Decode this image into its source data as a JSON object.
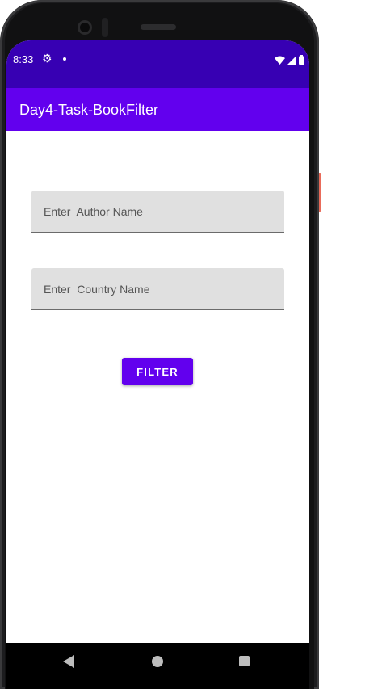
{
  "status_bar": {
    "time": "8:33",
    "icons": [
      "gear-icon",
      "notification-dot-icon",
      "wifi-icon",
      "cell-signal-icon",
      "battery-icon"
    ]
  },
  "app_bar": {
    "title": "Day4-Task-BookFilter"
  },
  "form": {
    "author_field": {
      "placeholder": "Enter  Author Name",
      "value": ""
    },
    "country_field": {
      "placeholder": "Enter  Country Name",
      "value": ""
    },
    "filter_button_label": "FILTER"
  },
  "nav_bar": {
    "icons": [
      "back-icon",
      "home-icon",
      "recents-icon"
    ]
  },
  "colors": {
    "primary": "#6200ee",
    "primary_dark": "#3700b3",
    "field_background": "#e0e0e0"
  }
}
